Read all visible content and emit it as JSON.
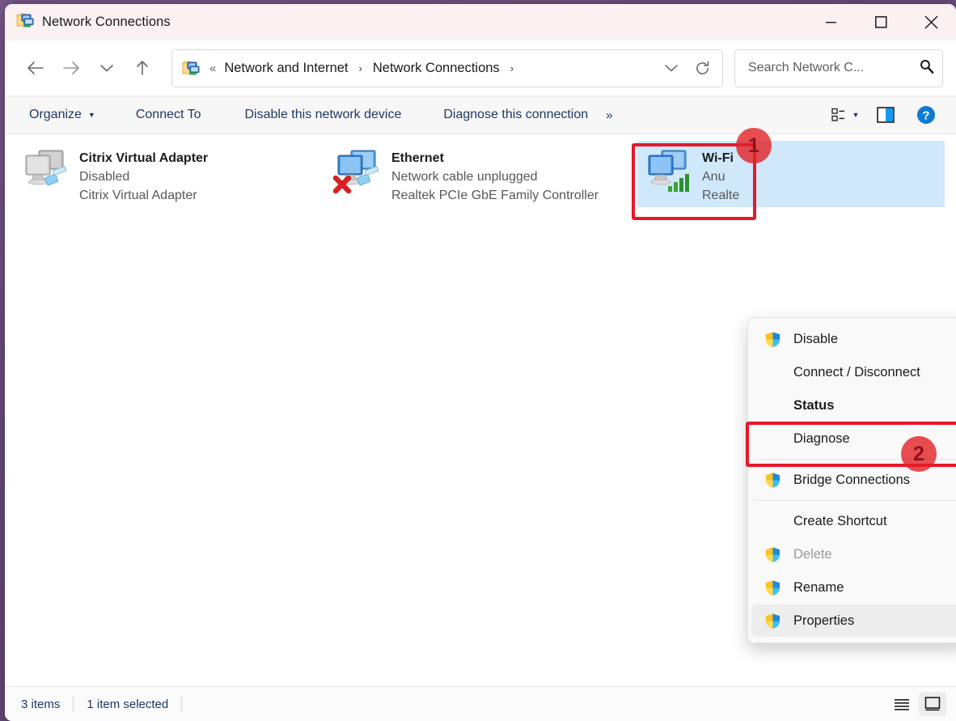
{
  "window": {
    "title": "Network Connections",
    "icon": "network-connections-icon",
    "controls": {
      "minimize": "Minimize",
      "maximize": "Maximize",
      "close": "Close"
    }
  },
  "nav": {
    "back": "Back",
    "forward": "Forward",
    "recent": "Recent locations",
    "up": "Up",
    "address": {
      "icon": "network-connections-icon",
      "overflow": "«",
      "crumbs": [
        {
          "label": "Network and Internet"
        },
        {
          "label": "Network Connections"
        }
      ],
      "separator": "›",
      "dropdown": "Previous locations",
      "refresh": "Refresh"
    },
    "search": {
      "placeholder": "Search Network C...",
      "value": "",
      "icon": "search-icon"
    }
  },
  "commandbar": {
    "items": [
      {
        "label": "Organize",
        "has_caret": true
      },
      {
        "label": "Connect To",
        "has_caret": false
      },
      {
        "label": "Disable this network device",
        "has_caret": false
      },
      {
        "label": "Diagnose this connection",
        "has_caret": false
      }
    ],
    "overflow": "»",
    "view_button": "view-options-icon",
    "view_caret": "chevron-down-icon",
    "preview_pane_button": "preview-pane-icon",
    "help_button": "help-icon"
  },
  "connections": [
    {
      "name": "Citrix Virtual Adapter",
      "status": "Disabled",
      "device": "Citrix Virtual Adapter",
      "icon": "adapter-disabled-icon",
      "selected": false
    },
    {
      "name": "Ethernet",
      "status": "Network cable unplugged",
      "device": "Realtek PCIe GbE Family Controller",
      "icon": "adapter-unplugged-icon",
      "selected": false
    },
    {
      "name": "Wi-Fi",
      "status": "Anu",
      "device": "Realte",
      "icon": "adapter-wireless-icon",
      "selected": true
    }
  ],
  "context_menu": {
    "groups": [
      {
        "items": [
          {
            "label": "Disable",
            "shield": true,
            "bold": false,
            "disabled": false,
            "hovered": false
          },
          {
            "label": "Connect / Disconnect",
            "shield": false,
            "bold": false,
            "disabled": false,
            "hovered": false
          },
          {
            "label": "Status",
            "shield": false,
            "bold": true,
            "disabled": false,
            "hovered": false
          },
          {
            "label": "Diagnose",
            "shield": false,
            "bold": false,
            "disabled": false,
            "hovered": false
          }
        ]
      },
      {
        "items": [
          {
            "label": "Bridge Connections",
            "shield": true,
            "bold": false,
            "disabled": false,
            "hovered": false
          }
        ]
      },
      {
        "items": [
          {
            "label": "Create Shortcut",
            "shield": false,
            "bold": false,
            "disabled": false,
            "hovered": false
          },
          {
            "label": "Delete",
            "shield": true,
            "bold": false,
            "disabled": true,
            "hovered": false
          },
          {
            "label": "Rename",
            "shield": true,
            "bold": false,
            "disabled": false,
            "hovered": false
          },
          {
            "label": "Properties",
            "shield": true,
            "bold": false,
            "disabled": false,
            "hovered": true
          }
        ]
      }
    ]
  },
  "statusbar": {
    "item_count": "3 items",
    "selection": "1 item selected",
    "details_view": "details-view-icon",
    "large_icons_view": "large-icons-view-icon"
  },
  "annotations": {
    "accent_color": "#e8172a",
    "markers": [
      {
        "number": "1",
        "target": "wifi-connection-tile"
      },
      {
        "number": "2",
        "target": "context-menu-properties"
      }
    ]
  }
}
